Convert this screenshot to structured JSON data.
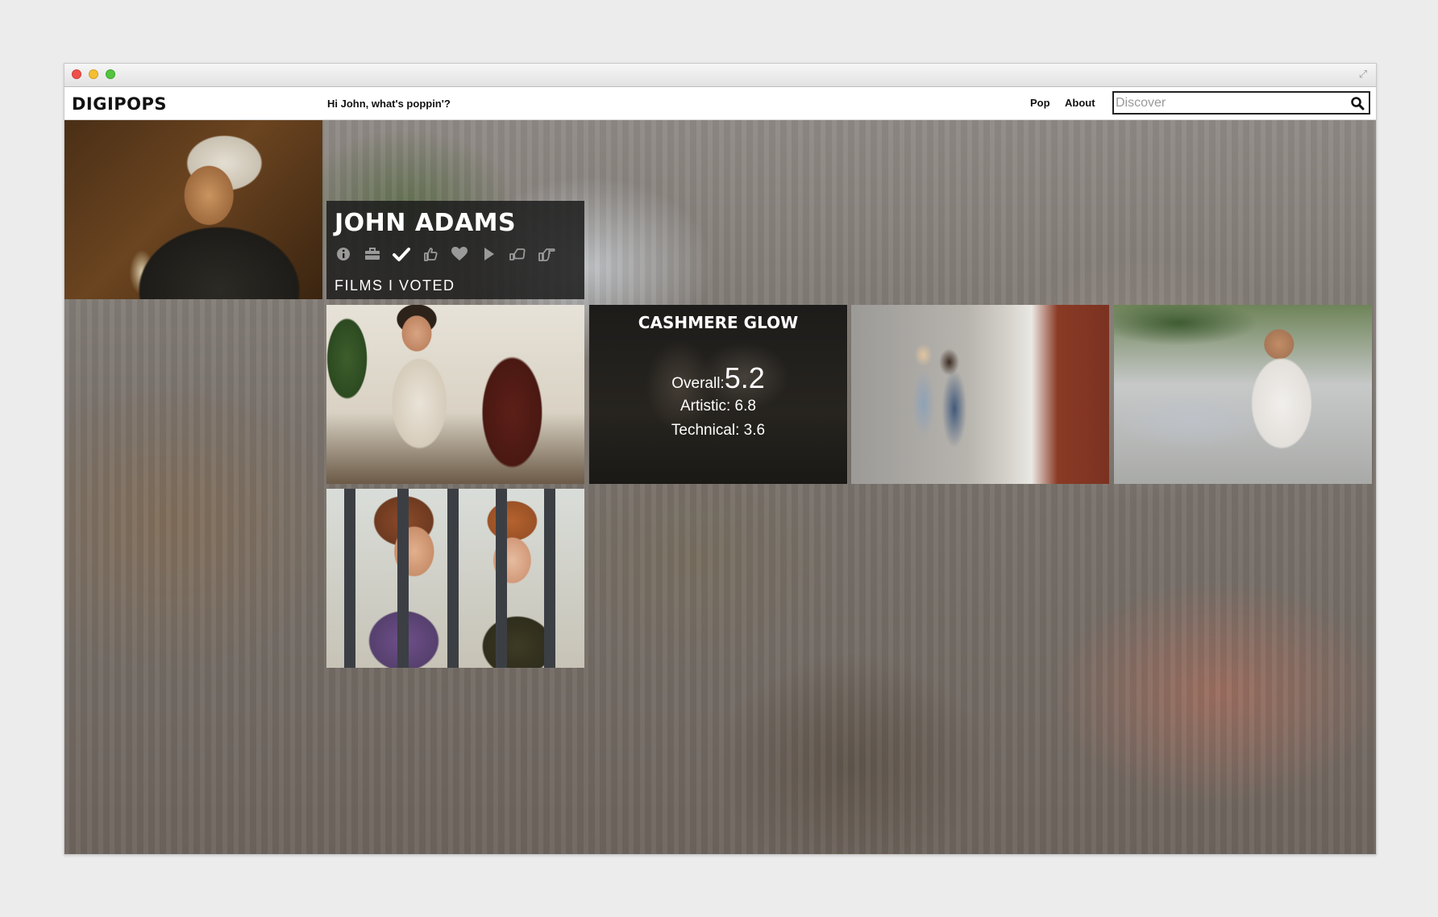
{
  "navbar": {
    "logo": "DIGIPOPS",
    "greeting": "Hi John, what's poppin'?",
    "links": [
      "Pop",
      "About"
    ],
    "search_placeholder": "Discover"
  },
  "profile": {
    "name": "JOHN ADAMS",
    "subtitle": "FILMS I VOTED",
    "icons": [
      "info-icon",
      "briefcase-icon",
      "checkmark-icon",
      "thumbs-up-icon",
      "heart-icon",
      "play-icon",
      "hand-down-icon",
      "hand-point-icon"
    ],
    "active_icon": "checkmark-icon"
  },
  "rating": {
    "title": "CASHMERE GLOW",
    "overall_label": "Overall:",
    "overall_value": "5.2",
    "artistic": "Artistic: 6.8",
    "technical": "Technical: 3.6"
  },
  "colors": {
    "card_bg": "#1c1c1c",
    "text_on_dark": "#ffffff",
    "icon_inactive": "#9a9a9a"
  }
}
